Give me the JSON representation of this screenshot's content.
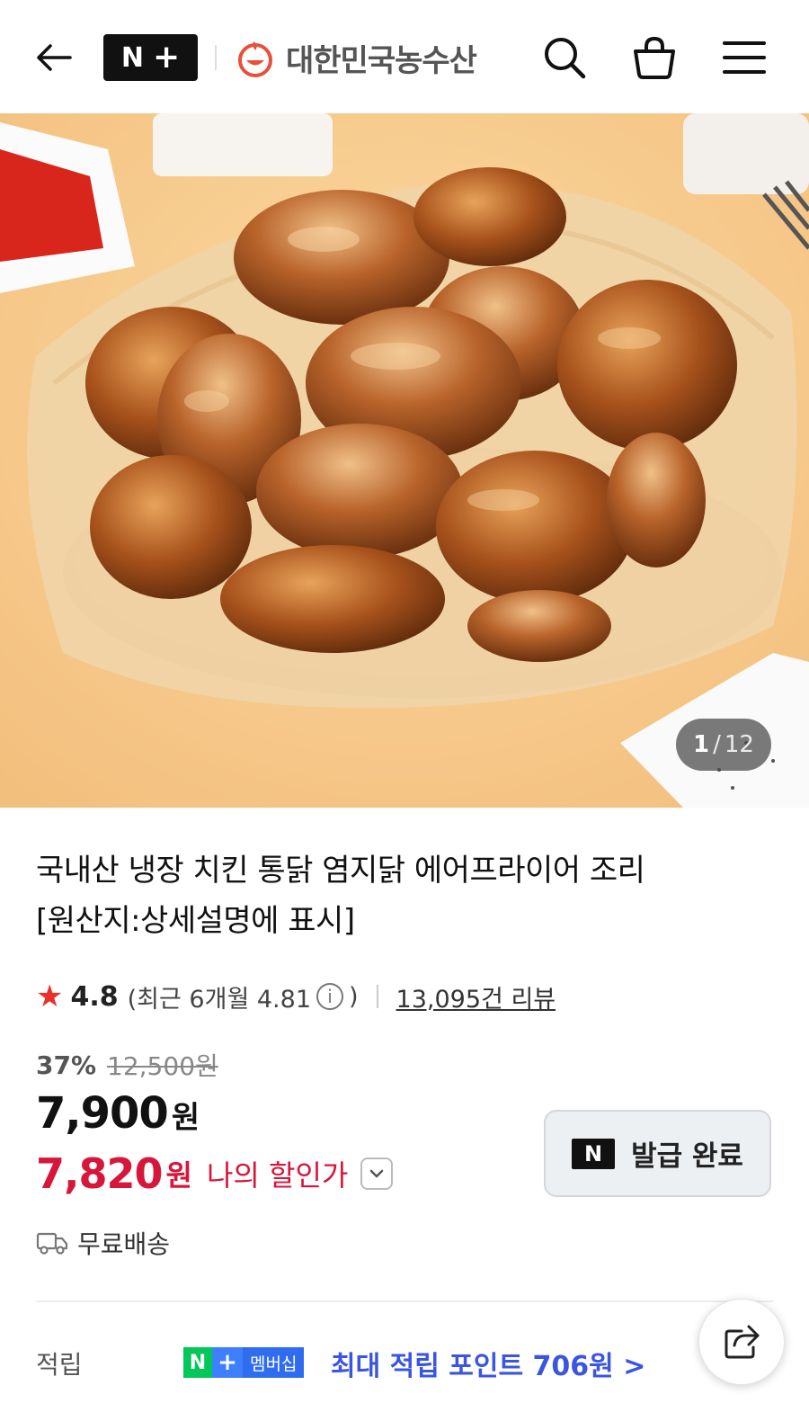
{
  "header": {
    "back_label": "←",
    "np_n": "N",
    "np_plus": "+",
    "store_name": "대한민국농수산"
  },
  "hero": {
    "current": "1",
    "separator": "/",
    "total": "12"
  },
  "product": {
    "title_line1": "국내산 냉장 치킨 통닭 염지닭 에어프라이어 조리",
    "title_line2": "[원산지:상세설명에 표시]",
    "rating": "4.8",
    "recent_rating": "(최근 6개월 4.81",
    "recent_close": ")",
    "info_icon": "i",
    "review_count": "13,095건 리뷰",
    "discount_pct": "37%",
    "original_price": "12,500원",
    "price": "7,900",
    "price_unit": "원",
    "my_price": "7,820",
    "my_price_unit": "원",
    "my_price_label": "나의 할인가",
    "coupon_badge": "N",
    "coupon_label": "발급 완료",
    "shipping": "무료배송"
  },
  "points": {
    "label": "적립",
    "badge_n": "N",
    "badge_plus": "+",
    "badge_membership": "멤버십",
    "max_points": "최대 적립 포인트 706원 >"
  },
  "colors": {
    "accent_red": "#d6163a",
    "star": "#e8312a",
    "naver_green": "#03c75a",
    "points_blue": "#3a55e0"
  },
  "icons": [
    "back-arrow-icon",
    "search-icon",
    "cart-icon",
    "menu-icon",
    "star-icon",
    "info-icon",
    "chevron-down-icon",
    "truck-icon",
    "share-icon",
    "store-logo-icon"
  ]
}
